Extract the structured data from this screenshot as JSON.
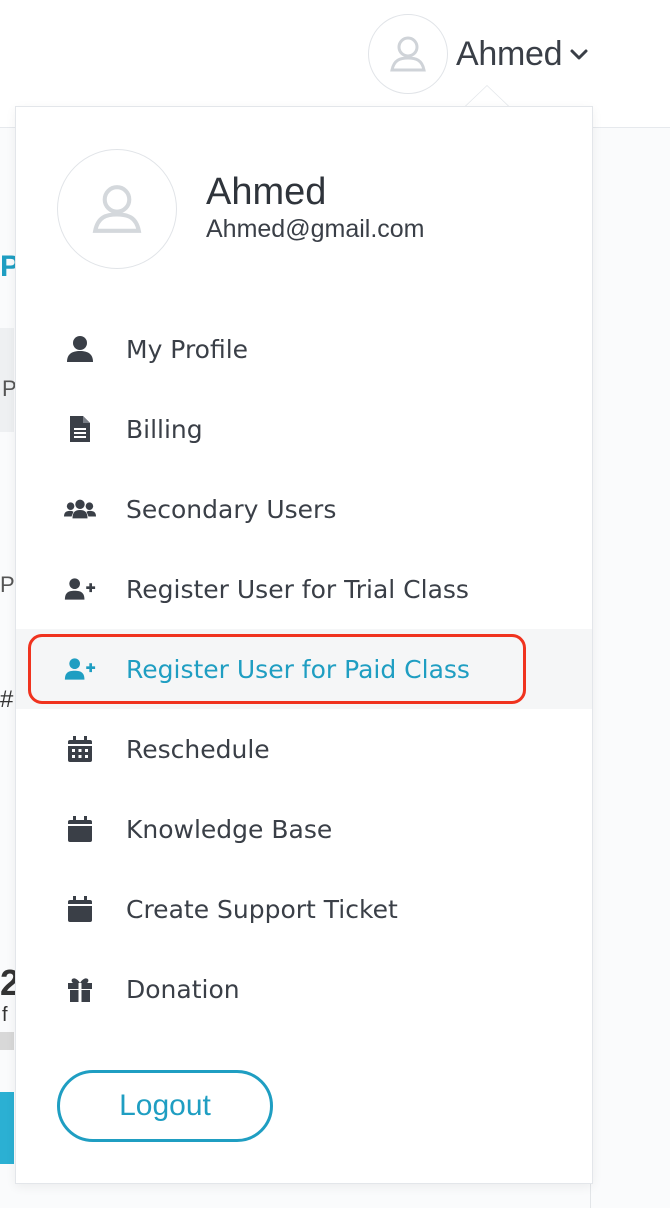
{
  "header": {
    "user_name": "Ahmed"
  },
  "background": {
    "fragments": [
      "P",
      "P",
      "P",
      "#",
      "2",
      "f"
    ]
  },
  "dropdown": {
    "name": "Ahmed",
    "email": "Ahmed@gmail.com",
    "items": [
      {
        "label": "My Profile",
        "icon": "user-icon"
      },
      {
        "label": "Billing",
        "icon": "document-icon"
      },
      {
        "label": "Secondary Users",
        "icon": "users-icon"
      },
      {
        "label": "Register User for Trial Class",
        "icon": "user-plus-icon"
      },
      {
        "label": "Register User for Paid Class",
        "icon": "user-plus-icon",
        "active": true
      },
      {
        "label": "Reschedule",
        "icon": "calendar-grid-icon"
      },
      {
        "label": "Knowledge Base",
        "icon": "calendar-icon"
      },
      {
        "label": "Create Support Ticket",
        "icon": "calendar-icon"
      },
      {
        "label": "Donation",
        "icon": "gift-icon"
      }
    ],
    "logout_label": "Logout"
  },
  "colors": {
    "accent": "#1f9ec2",
    "highlight": "#f0331f",
    "text": "#3a3f47"
  }
}
